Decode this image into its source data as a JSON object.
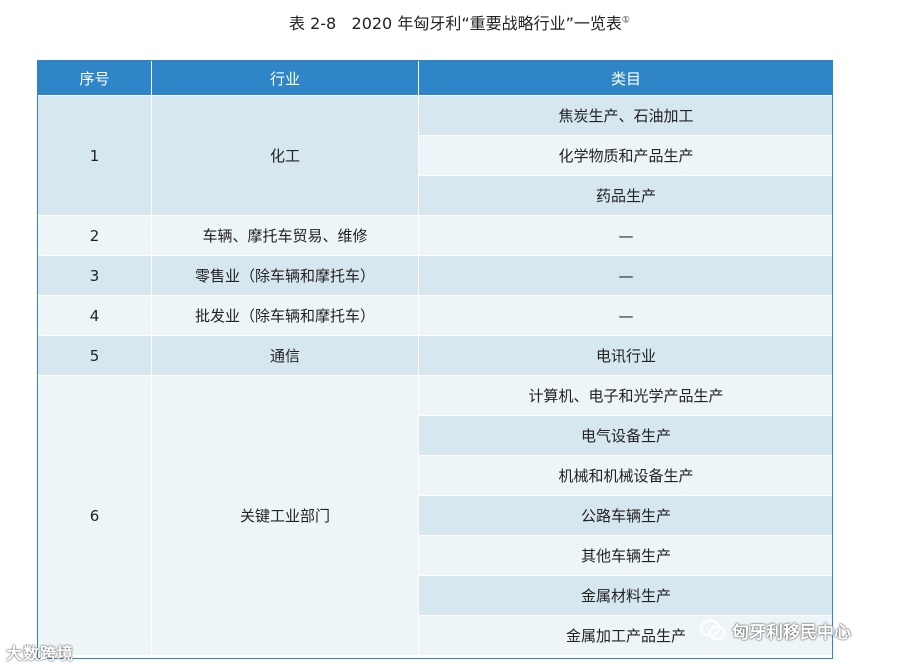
{
  "caption": {
    "label": "表 2-8",
    "title": "2020 年匈牙利“重要战略行业”一览表",
    "footnote": "①"
  },
  "table": {
    "headers": [
      "序号",
      "行业",
      "类目"
    ],
    "groups": [
      {
        "no": "1",
        "industry": "化工",
        "categories": [
          "焦炭生产、石油加工",
          "化学物质和产品生产",
          "药品生产"
        ]
      },
      {
        "no": "2",
        "industry": "车辆、摩托车贸易、维修",
        "categories": [
          "—"
        ]
      },
      {
        "no": "3",
        "industry": "零售业（除车辆和摩托车）",
        "categories": [
          "—"
        ]
      },
      {
        "no": "4",
        "industry": "批发业（除车辆和摩托车）",
        "categories": [
          "—"
        ]
      },
      {
        "no": "5",
        "industry": "通信",
        "categories": [
          "电讯行业"
        ]
      },
      {
        "no": "6",
        "industry": "关键工业部门",
        "categories": [
          "计算机、电子和光学产品生产",
          "电气设备生产",
          "机械和机械设备生产",
          "公路车辆生产",
          "其他车辆生产",
          "金属材料生产",
          "金属加工产品生产"
        ]
      }
    ]
  },
  "watermarks": {
    "left": "大数跨境",
    "right": "匈牙利移民中心"
  },
  "colors": {
    "header": "#2e86c8",
    "row_dark": "#d6e7ef",
    "row_light": "#eef5f8"
  }
}
